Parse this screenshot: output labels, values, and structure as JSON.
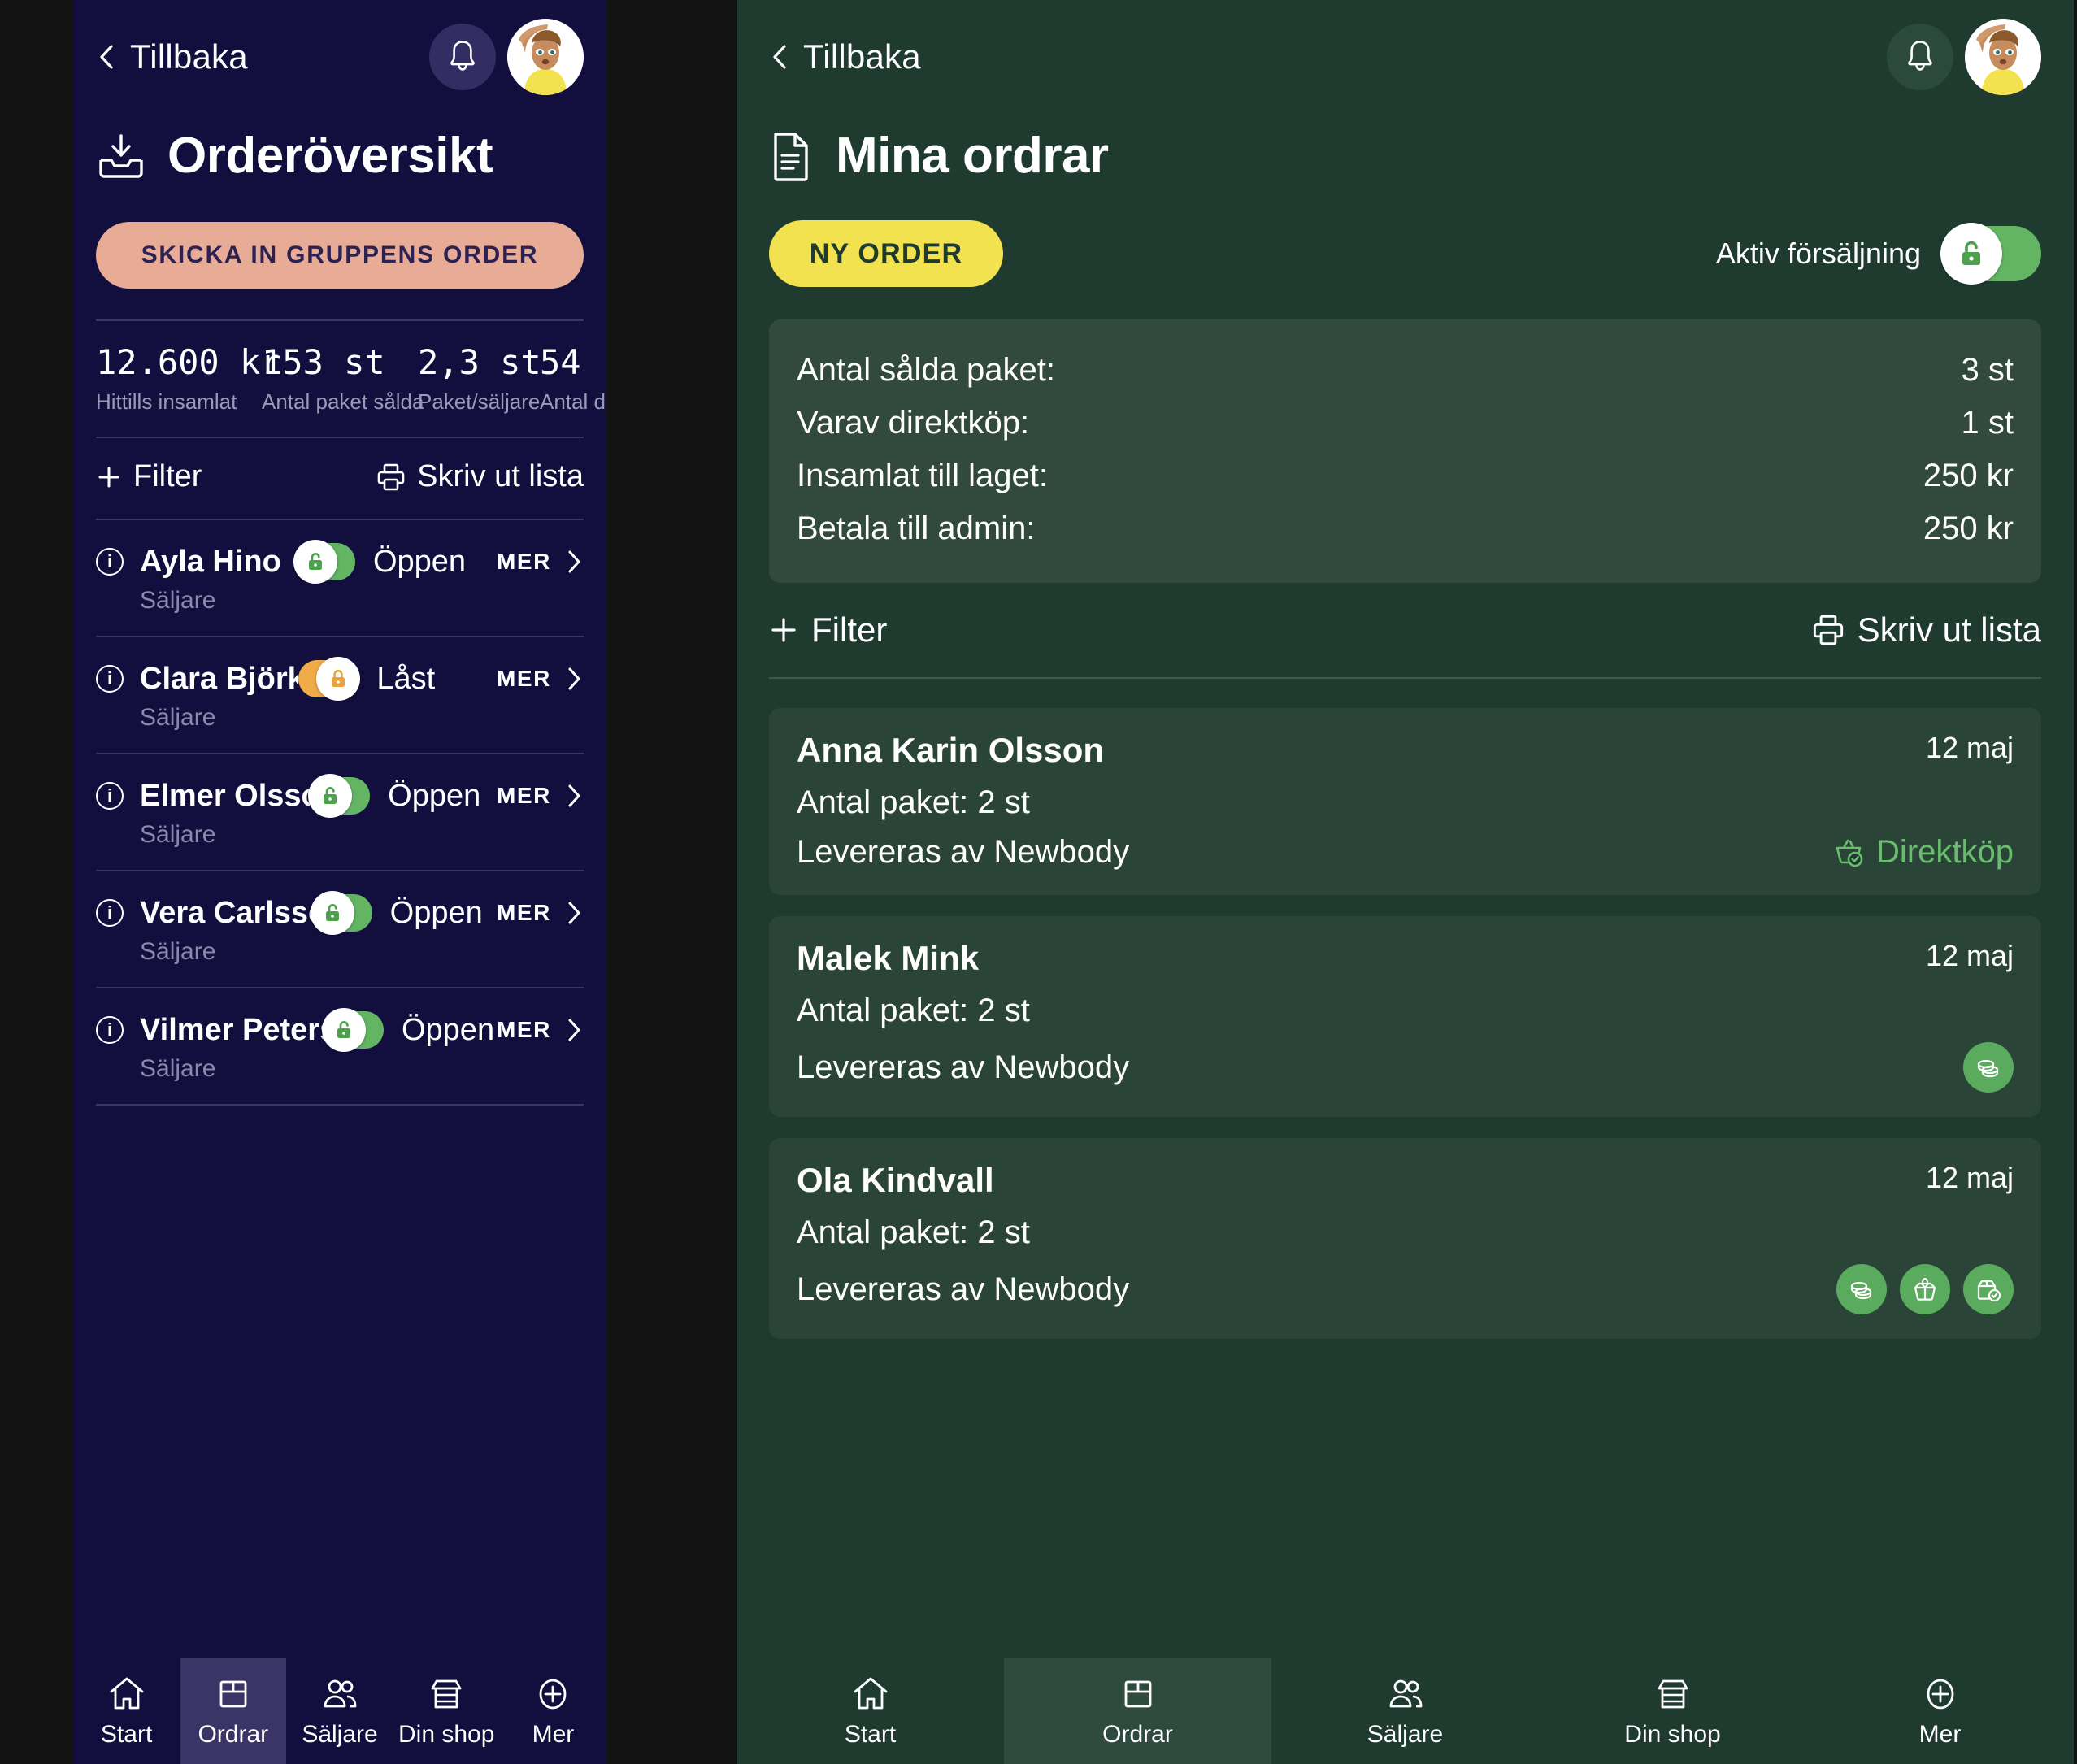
{
  "theme": {
    "left_bg": "#120f3f",
    "right_bg": "#1f3b30",
    "outer_bg": "#131313",
    "left_cta_bg": "#e8ab95",
    "left_cta_fg": "#2b2152",
    "right_cta_bg": "#f2e24f",
    "right_cta_fg": "#1f3b30",
    "toggle_open": "#63b463",
    "toggle_locked": "#eeab48",
    "badge_green": "#5aab5e",
    "direct_green": "#6abd6e",
    "muted_left": "#9a9ab8",
    "card_green": "#32493d",
    "order_card_green": "#2b4438",
    "nav_active_left": "#3a3566",
    "nav_active_right": "#2f4a3e"
  },
  "left_panel": {
    "topbar": {
      "back_label": "Tillbaka",
      "back_icon": "chevron-left-icon",
      "bell_icon": "bell-icon",
      "avatar_icon": "user-avatar"
    },
    "header": {
      "icon": "inbox-download-icon",
      "title": "Orderöversikt"
    },
    "cta": {
      "label": "SKICKA IN GRUPPENS ORDER"
    },
    "stats": [
      {
        "value": "12.600 kr",
        "label": "Hittills insamlat"
      },
      {
        "value": "153 st",
        "label": "Antal paket sålda"
      },
      {
        "value": "2,3 st",
        "label": "Paket/säljare"
      },
      {
        "value": "54",
        "label": "Antal dire"
      }
    ],
    "toolbar": {
      "filter_label": "Filter",
      "filter_icon": "plus-icon",
      "print_label": "Skriv ut lista",
      "print_icon": "printer-icon"
    },
    "sellers": [
      {
        "name": "Ayla Hino",
        "role": "Säljare",
        "state": "Öppen",
        "locked": false,
        "more": "MER",
        "info_icon": "info-icon",
        "toggle_icon": "unlock-icon",
        "chevron_icon": "chevron-right-icon"
      },
      {
        "name": "Clara Björk",
        "role": "Säljare",
        "state": "Låst",
        "locked": true,
        "more": "MER",
        "info_icon": "info-icon",
        "toggle_icon": "lock-icon",
        "chevron_icon": "chevron-right-icon"
      },
      {
        "name": "Elmer Olsson",
        "role": "Säljare",
        "state": "Öppen",
        "locked": false,
        "more": "MER",
        "info_icon": "info-icon",
        "toggle_icon": "unlock-icon",
        "chevron_icon": "chevron-right-icon"
      },
      {
        "name": "Vera Carlsson",
        "role": "Säljare",
        "state": "Öppen",
        "locked": false,
        "more": "MER",
        "info_icon": "info-icon",
        "toggle_icon": "unlock-icon",
        "chevron_icon": "chevron-right-icon"
      },
      {
        "name": "Vilmer Petersson",
        "role": "Säljare",
        "state": "Öppen",
        "locked": false,
        "more": "MER",
        "info_icon": "info-icon",
        "toggle_icon": "unlock-icon",
        "chevron_icon": "chevron-right-icon"
      }
    ],
    "bottom_nav": {
      "active_index": 1,
      "items": [
        {
          "label": "Start",
          "icon": "home-icon"
        },
        {
          "label": "Ordrar",
          "icon": "box-icon"
        },
        {
          "label": "Säljare",
          "icon": "people-icon"
        },
        {
          "label": "Din shop",
          "icon": "shop-icon"
        },
        {
          "label": "Mer",
          "icon": "plus-circle-icon"
        }
      ]
    }
  },
  "right_panel": {
    "topbar": {
      "back_label": "Tillbaka",
      "back_icon": "chevron-left-icon",
      "bell_icon": "bell-icon",
      "avatar_icon": "user-avatar"
    },
    "header": {
      "icon": "document-icon",
      "title": "Mina ordrar"
    },
    "cta": {
      "label": "NY ORDER"
    },
    "sales_toggle": {
      "label": "Aktiv försäljning",
      "state_on": true,
      "icon": "unlock-icon"
    },
    "summary": [
      {
        "label": "Antal sålda paket:",
        "value": "3 st"
      },
      {
        "label": "Varav direktköp:",
        "value": "1 st"
      },
      {
        "label": "Insamlat till laget:",
        "value": "250 kr"
      },
      {
        "label": "Betala till admin:",
        "value": "250 kr"
      }
    ],
    "toolbar": {
      "filter_label": "Filter",
      "filter_icon": "plus-icon",
      "print_label": "Skriv ut lista",
      "print_icon": "printer-icon"
    },
    "orders": [
      {
        "name": "Anna Karin Olsson",
        "date": "12 maj",
        "packages": "Antal paket: 2 st",
        "delivery": "Levereras av Newbody",
        "direct_label": "Direktköp",
        "direct_icon": "basket-check-icon",
        "badges": []
      },
      {
        "name": "Malek Mink",
        "date": "12 maj",
        "packages": "Antal paket: 2 st",
        "delivery": "Levereras av Newbody",
        "direct_label": "",
        "badges": [
          "coins-icon"
        ]
      },
      {
        "name": "Ola Kindvall",
        "date": "12 maj",
        "packages": "Antal paket: 2 st",
        "delivery": "Levereras av Newbody",
        "direct_label": "",
        "badges": [
          "coins-icon",
          "open-box-icon",
          "box-check-icon"
        ]
      }
    ],
    "bottom_nav": {
      "active_index": 1,
      "items": [
        {
          "label": "Start",
          "icon": "home-icon"
        },
        {
          "label": "Ordrar",
          "icon": "box-icon"
        },
        {
          "label": "Säljare",
          "icon": "people-icon"
        },
        {
          "label": "Din shop",
          "icon": "shop-icon"
        },
        {
          "label": "Mer",
          "icon": "plus-circle-icon"
        }
      ]
    }
  }
}
